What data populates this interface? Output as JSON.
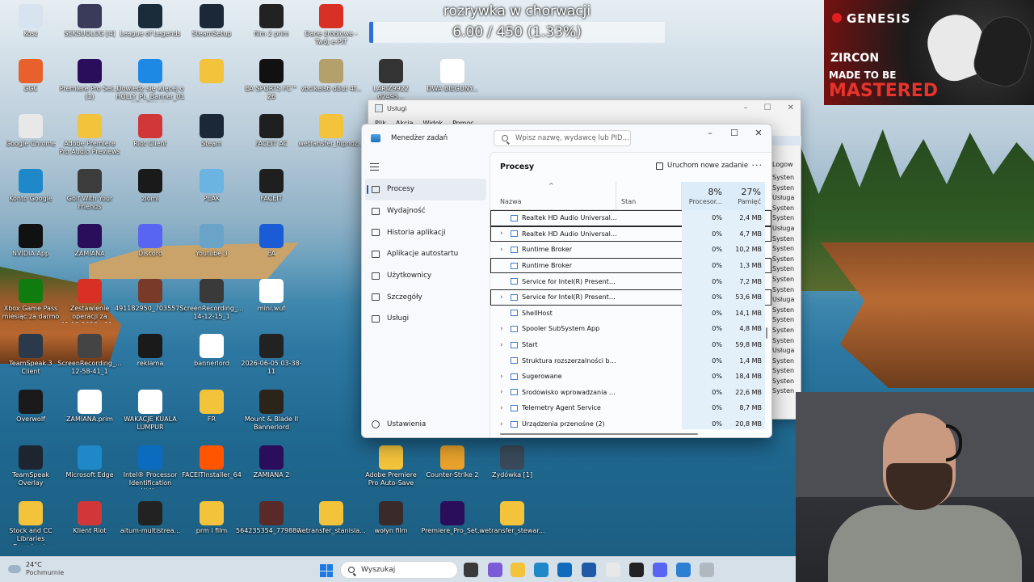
{
  "overlay": {
    "title": "rozrywka w chorwacji",
    "progress_text": "6.00 / 450 (1.33%)",
    "progress_fraction": 0.0133
  },
  "ad": {
    "brand": "GENESIS",
    "model": "ZIRCON",
    "tag_line1": "MADE TO BE",
    "tag_line2": "MASTERED"
  },
  "desktop_icons": [
    {
      "label": "Kosz",
      "icon": "recycle-bin-icon",
      "color": "#d7e3ee"
    },
    {
      "label": "SEKSUOLOG [4]",
      "icon": "video-file-icon",
      "color": "#3a3a5a"
    },
    {
      "label": "League of Legends",
      "icon": "league-icon",
      "color": "#1a2b3a"
    },
    {
      "label": "SteamSetup",
      "icon": "steam-icon",
      "color": "#1b2838"
    },
    {
      "label": "film 2 prim",
      "icon": "clapperboard-icon",
      "color": "#222222"
    },
    {
      "label": "Dane źródłowe - Twój e-PIT",
      "icon": "pdf-icon",
      "color": "#d93025"
    },
    {
      "label": "GGC",
      "icon": "ggc-icon",
      "color": "#e8612c"
    },
    {
      "label": "Premiere Pro Set... (1)",
      "icon": "premiere-icon",
      "color": "#2a0e5c"
    },
    {
      "label": "Dowiedz się więcej o HOLLY_PL_Banner_01 tym zdjęciu",
      "icon": "info-icon",
      "color": "#1e88e5"
    },
    {
      "label": "",
      "icon": "folder-icon",
      "color": "#f3c33c"
    },
    {
      "label": "EA SPORTS FC™ 26",
      "icon": "easports-icon",
      "color": "#111111"
    },
    {
      "label": "vbcikeis6 d8ut 4f...",
      "icon": "archive-icon",
      "color": "#b4a06a"
    },
    {
      "label": "LARIZ9922 d2495...",
      "icon": "film-icon",
      "color": "#333333"
    },
    {
      "label": "DWA BIEGUNY...",
      "icon": "document-icon",
      "color": "#ffffff"
    },
    {
      "label": "Google Chrome",
      "icon": "chrome-icon",
      "color": "#e8e8e8"
    },
    {
      "label": "Adobe Premiere Pro Audio Previews",
      "icon": "folder-icon",
      "color": "#f3c33c"
    },
    {
      "label": "Riot Client",
      "icon": "riot-icon",
      "color": "#d13639"
    },
    {
      "label": "Steam",
      "icon": "steam-icon",
      "color": "#1b2838"
    },
    {
      "label": "FACEIT AC",
      "icon": "faceit-icon",
      "color": "#1f1f1f"
    },
    {
      "label": "wetransfer_hipnoz...",
      "icon": "folder-icon",
      "color": "#f3c33c"
    },
    {
      "label": "Konto Google",
      "icon": "edge-icon",
      "color": "#1e88c8"
    },
    {
      "label": "Golf With Your Friends",
      "icon": "golf-icon",
      "color": "#3c3c3c"
    },
    {
      "label": "ziomi",
      "icon": "image-file-icon",
      "color": "#1a1a1a"
    },
    {
      "label": "PEAK",
      "icon": "peak-icon",
      "color": "#6bb3e0"
    },
    {
      "label": "FACEIT",
      "icon": "faceit-icon",
      "color": "#1f1f1f"
    },
    {
      "label": "NVIDIA App",
      "icon": "nvidia-icon",
      "color": "#111111"
    },
    {
      "label": "ZAMIANA",
      "icon": "premiere-project-icon",
      "color": "#2a0e5c"
    },
    {
      "label": "Discord",
      "icon": "discord-icon",
      "color": "#5865f2"
    },
    {
      "label": "Youtube 3",
      "icon": "image-file-icon",
      "color": "#6aa3c8"
    },
    {
      "label": "EA",
      "icon": "ea-icon",
      "color": "#1a5bd6"
    },
    {
      "label": "Xbox Game Pass miesiąc za darmo",
      "icon": "xbox-icon",
      "color": "#107c10"
    },
    {
      "label": "Zestawienie operacji za 01.12.2025 - 31...",
      "icon": "pdf-icon",
      "color": "#d93025"
    },
    {
      "label": "491182950_703557...",
      "icon": "image-file-icon",
      "color": "#7a3a2a"
    },
    {
      "label": "ScreenRecording_... 14-12-15_1",
      "icon": "video-file-icon",
      "color": "#3a3a3a"
    },
    {
      "label": "mini.wuf",
      "icon": "document-icon",
      "color": "#ffffff"
    },
    {
      "label": "TeamSpeak 3 Client",
      "icon": "teamspeak-icon",
      "color": "#2a3a4a"
    },
    {
      "label": "ScreenRecording_... 12-58-41_1",
      "icon": "video-file-icon",
      "color": "#444444"
    },
    {
      "label": "reklama",
      "icon": "image-file-icon",
      "color": "#1a1a1a"
    },
    {
      "label": "bannerlord",
      "icon": "document-icon",
      "color": "#ffffff"
    },
    {
      "label": "2026-06-05 03-38-11",
      "icon": "video-file-icon",
      "color": "#222222"
    },
    {
      "label": "Overwolf",
      "icon": "overwolf-icon",
      "color": "#1a1a1a"
    },
    {
      "label": "ZAMIANA.prim",
      "icon": "prim-file-icon",
      "color": "#ffffff"
    },
    {
      "label": "WAKACJE KUALA LUMPUR",
      "icon": "document-icon",
      "color": "#ffffff"
    },
    {
      "label": "FR",
      "icon": "folder-icon",
      "color": "#f3c33c"
    },
    {
      "label": "Mount & Blade II Bannerlord",
      "icon": "bannerlord-icon",
      "color": "#2b2418"
    },
    {
      "label": "TeamSpeak Overlay",
      "icon": "teamspeak-icon",
      "color": "#1c2530"
    },
    {
      "label": "Microsoft Edge",
      "icon": "edge-icon",
      "color": "#1e88c8"
    },
    {
      "label": "Intel® Processor Identification Utility",
      "icon": "intel-icon",
      "color": "#0b6bbf"
    },
    {
      "label": "FACEITInstaller_64",
      "icon": "faceit-icon",
      "color": "#ff5500"
    },
    {
      "label": "ZAMIANA 2",
      "icon": "premiere-project-icon",
      "color": "#2a0e5c"
    },
    {
      "label": "Adobe Premiere Pro Auto-Save",
      "icon": "folder-icon",
      "color": "#f3c33c"
    },
    {
      "label": "Counter-Strike 2",
      "icon": "cs2-icon",
      "color": "#e8a22c"
    },
    {
      "label": "Zydówka [1]",
      "icon": "image-file-icon",
      "color": "#3a4a5a"
    },
    {
      "label": "Stock and CC Libraries Downloads",
      "icon": "folder-icon",
      "color": "#f3c33c"
    },
    {
      "label": "Klient Riot",
      "icon": "riot-icon",
      "color": "#d13639"
    },
    {
      "label": "aitum-multistrea...",
      "icon": "aitum-icon",
      "color": "#222222"
    },
    {
      "label": "prm i film",
      "icon": "folder-icon",
      "color": "#f3c33c"
    },
    {
      "label": "564235354_779887...",
      "icon": "image-file-icon",
      "color": "#5a2a2a"
    },
    {
      "label": "wetransfer_stanisla...",
      "icon": "folder-icon",
      "color": "#f3c33c"
    },
    {
      "label": "wołyn film",
      "icon": "image-file-icon",
      "color": "#3a2a2a"
    },
    {
      "label": "Premiere_Pro_Set...",
      "icon": "premiere-icon",
      "color": "#2a0e5c"
    },
    {
      "label": "wetransfer_stewar...",
      "icon": "folder-icon",
      "color": "#f3c33c"
    }
  ],
  "services_window": {
    "title": "Usługi",
    "menu": [
      "Plik",
      "Akcja",
      "Widok",
      "Pomoc"
    ],
    "col_header": "Logow",
    "rows": [
      "Systen",
      "Systen",
      "Usługa",
      "Systen",
      "Systen",
      "Usługa",
      "Systen",
      "Systen",
      "Systen",
      "Systen",
      "Systen",
      "Systen",
      "Usługa",
      "Systen",
      "Systen",
      "Systen",
      "Systen",
      "Usługa",
      "Systen",
      "Systen",
      "Systen",
      "Systen"
    ]
  },
  "task_manager": {
    "title": "Menedżer zadań",
    "search_placeholder": "Wpisz nazwę, wydawcę lub PID...",
    "nav": [
      {
        "label": "Procesy",
        "icon": "processes-icon",
        "active": true
      },
      {
        "label": "Wydajność",
        "icon": "performance-icon",
        "active": false
      },
      {
        "label": "Historia aplikacji",
        "icon": "app-history-icon",
        "active": false
      },
      {
        "label": "Aplikacje autostartu",
        "icon": "startup-apps-icon",
        "active": false
      },
      {
        "label": "Użytkownicy",
        "icon": "users-icon",
        "active": false
      },
      {
        "label": "Szczegóły",
        "icon": "details-icon",
        "active": false
      },
      {
        "label": "Usługi",
        "icon": "services-icon",
        "active": false
      }
    ],
    "settings_label": "Ustawienia",
    "page_title": "Procesy",
    "run_task_label": "Uruchom nowe zadanie",
    "more_label": "···",
    "columns": {
      "name": "Nazwa",
      "status": "Stan",
      "cpu_pct": "8%",
      "cpu": "Procesor...",
      "mem_pct": "27%",
      "mem": "Pamięć"
    },
    "processes": [
      {
        "name": "Realtek HD Audio Universal Se...",
        "expandable": false,
        "cpu": "0%",
        "mem": "2,4 MB",
        "boxed": true
      },
      {
        "name": "Realtek HD Audio Universal Se...",
        "expandable": true,
        "cpu": "0%",
        "mem": "4,7 MB",
        "boxed": true
      },
      {
        "name": "Runtime Broker",
        "expandable": true,
        "cpu": "0%",
        "mem": "10,2 MB",
        "boxed": false
      },
      {
        "name": "Runtime Broker",
        "expandable": false,
        "cpu": "0%",
        "mem": "1,3 MB",
        "boxed": true
      },
      {
        "name": "Service for Intel(R) PresentMo...",
        "expandable": false,
        "cpu": "0%",
        "mem": "7,2 MB",
        "boxed": false
      },
      {
        "name": "Service for Intel(R) PresentMo...",
        "expandable": true,
        "cpu": "0%",
        "mem": "53,6 MB",
        "boxed": true
      },
      {
        "name": "ShellHost",
        "expandable": false,
        "cpu": "0%",
        "mem": "14,1 MB",
        "boxed": false
      },
      {
        "name": "Spooler SubSystem App",
        "expandable": true,
        "cpu": "0%",
        "mem": "4,8 MB",
        "boxed": false
      },
      {
        "name": "Start",
        "expandable": true,
        "cpu": "0%",
        "mem": "59,8 MB",
        "boxed": false
      },
      {
        "name": "Struktura rozszerzalności bezp...",
        "expandable": false,
        "cpu": "0%",
        "mem": "1,4 MB",
        "boxed": false
      },
      {
        "name": "Sugerowane",
        "expandable": true,
        "cpu": "0%",
        "mem": "18,4 MB",
        "boxed": false
      },
      {
        "name": "Środowisko wprowadzania da...",
        "expandable": true,
        "cpu": "0%",
        "mem": "22,6 MB",
        "boxed": false
      },
      {
        "name": "Telemetry Agent Service",
        "expandable": true,
        "cpu": "0%",
        "mem": "8,7 MB",
        "boxed": false
      },
      {
        "name": "Urządzenia przenośne (2)",
        "expandable": true,
        "cpu": "0%",
        "mem": "20,8 MB",
        "boxed": false
      }
    ]
  },
  "taskbar": {
    "temperature": "24°C",
    "weather": "Pochmurnie",
    "search_placeholder": "Wyszukaj"
  },
  "colors": {
    "accent": "#1a5fb4",
    "overlay_fill": "#2f6fd6",
    "cpu_column": "#dcecf8"
  }
}
